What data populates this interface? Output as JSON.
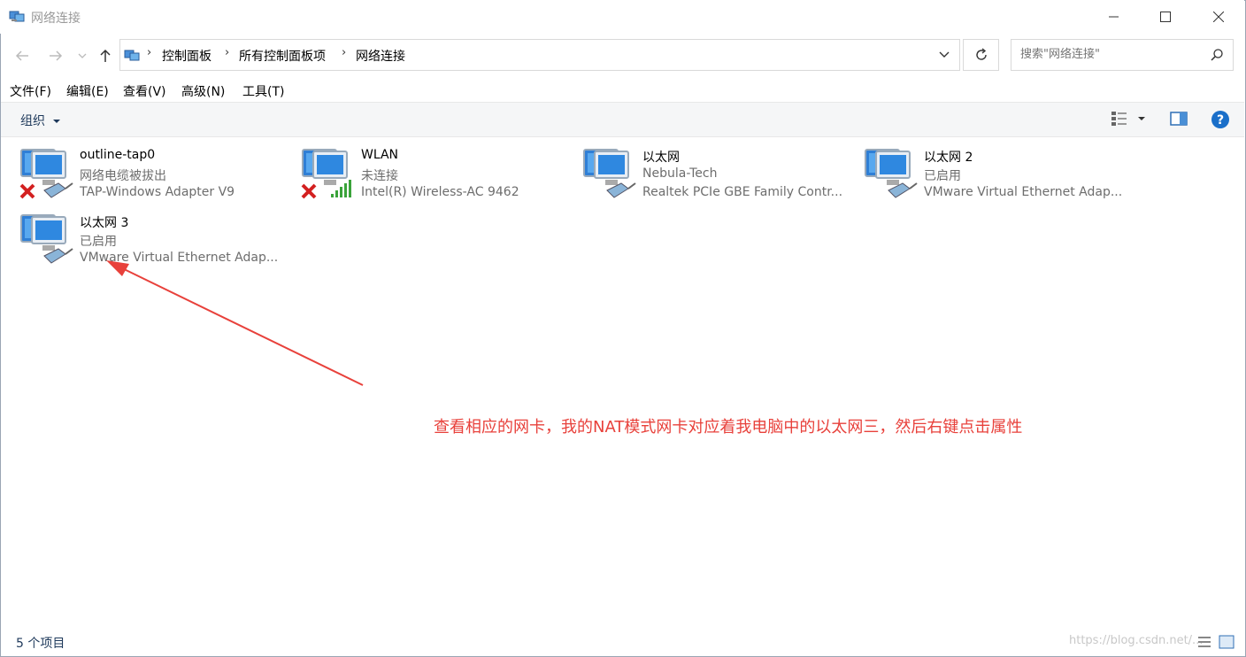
{
  "window": {
    "title": "网络连接"
  },
  "address": {
    "crumbs": [
      "控制面板",
      "所有控制面板项",
      "网络连接"
    ],
    "search_placeholder": "搜索\"网络连接\""
  },
  "menu": [
    "文件(F)",
    "编辑(E)",
    "查看(V)",
    "高级(N)",
    "工具(T)"
  ],
  "toolbar": {
    "organize": "组织"
  },
  "connections": [
    {
      "name": "outline-tap0",
      "status": "网络电缆被拔出",
      "adapter": "TAP-Windows Adapter V9",
      "type": "wired",
      "disconnected": true
    },
    {
      "name": "WLAN",
      "status": "未连接",
      "adapter": "Intel(R) Wireless-AC 9462",
      "type": "wireless",
      "disconnected": true
    },
    {
      "name": "以太网",
      "status": "Nebula-Tech",
      "adapter": "Realtek PCIe GBE Family Contr...",
      "type": "wired",
      "disconnected": false
    },
    {
      "name": "以太网 2",
      "status": "已启用",
      "adapter": "VMware Virtual Ethernet Adap...",
      "type": "wired",
      "disconnected": false
    },
    {
      "name": "以太网 3",
      "status": "已启用",
      "adapter": "VMware Virtual Ethernet Adap...",
      "type": "wired",
      "disconnected": false
    }
  ],
  "annotation": "查看相应的网卡，我的NAT模式网卡对应着我电脑中的以太网三，然后右键点击属性",
  "status": {
    "item_count": "5 个项目"
  },
  "watermark": "https://blog.csdn.net/..."
}
